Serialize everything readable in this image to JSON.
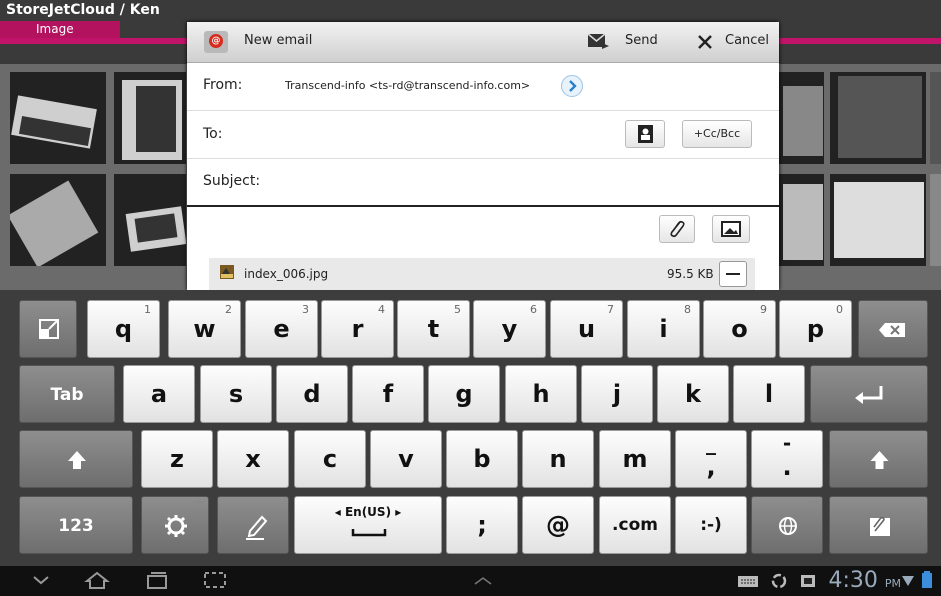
{
  "background_app": {
    "title": "StoreJetCloud / Ken",
    "tab_label": "Image"
  },
  "dialog": {
    "title": "New email",
    "send_label": "Send",
    "cancel_label": "Cancel",
    "from_label": "From:",
    "from_value": "Transcend-info <ts-rd@transcend-info.com>",
    "to_label": "To:",
    "ccbcc_label": "+Cc/Bcc",
    "subject_label": "Subject:",
    "attachment": {
      "name": "index_006.jpg",
      "size": "95.5 KB"
    }
  },
  "keyboard": {
    "row1": [
      {
        "key": "q",
        "hint": "1"
      },
      {
        "key": "w",
        "hint": "2"
      },
      {
        "key": "e",
        "hint": "3"
      },
      {
        "key": "r",
        "hint": "4"
      },
      {
        "key": "t",
        "hint": "5"
      },
      {
        "key": "y",
        "hint": "6"
      },
      {
        "key": "u",
        "hint": "7"
      },
      {
        "key": "i",
        "hint": "8"
      },
      {
        "key": "o",
        "hint": "9"
      },
      {
        "key": "p",
        "hint": "0"
      }
    ],
    "row2_tab": "Tab",
    "row2": [
      "a",
      "s",
      "d",
      "f",
      "g",
      "h",
      "j",
      "k",
      "l"
    ],
    "row3": [
      "z",
      "x",
      "c",
      "v",
      "b",
      "n",
      "m"
    ],
    "row3_comma_hint": "_",
    "row3_comma": ",",
    "row3_period_hint": "-",
    "row3_period": ".",
    "row4_num": "123",
    "row4_lang": "◂ En(US) ▸",
    "row4_semicolon": ";",
    "row4_at": "@",
    "row4_com": ".com",
    "row4_smiley": ":-)"
  },
  "status_bar": {
    "time": "4:30",
    "ampm": "PM"
  },
  "colors": {
    "accent": "#c2136a",
    "link_blue": "#2a7fc8"
  },
  "icons": [
    "back-icon",
    "home-icon",
    "recent-apps-icon",
    "screenshot-icon",
    "keyboard-icon",
    "recycle-icon",
    "photo-icon",
    "wifi-icon",
    "battery-icon"
  ]
}
